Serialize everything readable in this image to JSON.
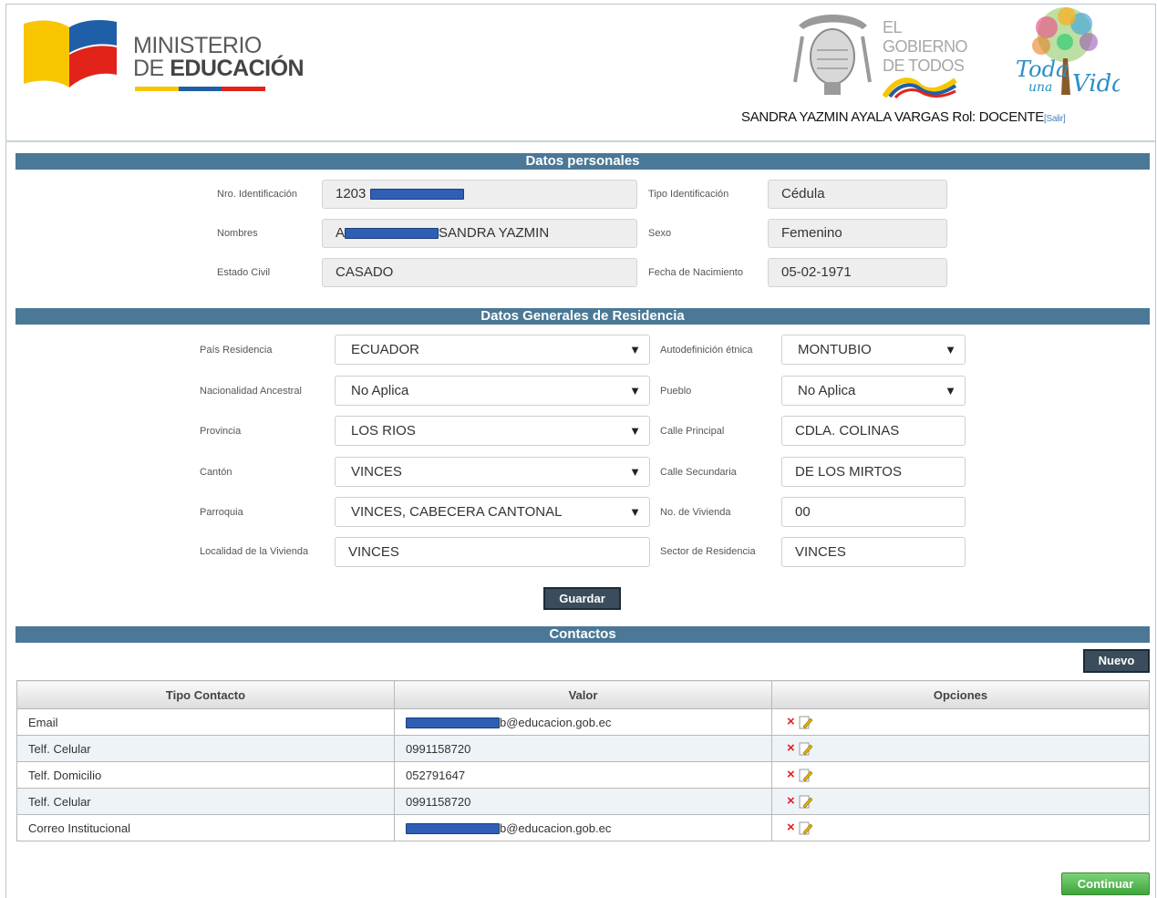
{
  "header": {
    "ministry_line1": "MINISTERIO",
    "ministry_line2_prefix": "DE ",
    "ministry_line2_bold": "EDUCACIÓN",
    "gov_line1": "EL",
    "gov_line2": "GOBIERNO",
    "gov_line3": "DE TODOS",
    "campaign_line1": "Toda",
    "campaign_line2": "una",
    "campaign_line3": "Vida",
    "user_text": "SANDRA YAZMIN AYALA VARGAS Rol: DOCENTE",
    "logout_label": "[Salir]",
    "colors": {
      "yellow": "#f7c600",
      "blue": "#1f5fa8",
      "red": "#e2231a"
    }
  },
  "personal": {
    "title": "Datos personales",
    "id_label": "Nro. Identificación",
    "id_value": "1203",
    "id_type_label": "Tipo Identificación",
    "id_type_value": "Cédula",
    "names_label": "Nombres",
    "names_prefix": "A",
    "names_value": "SANDRA YAZMIN",
    "sex_label": "Sexo",
    "sex_value": "Femenino",
    "civil_label": "Estado Civil",
    "civil_value": "CASADO",
    "birth_label": "Fecha de Nacimiento",
    "birth_value": "05-02-1971"
  },
  "residence": {
    "title": "Datos Generales de Residencia",
    "country_label": "País Residencia",
    "country_value": "ECUADOR",
    "ethnic_label": "Autodefinición étnica",
    "ethnic_value": "MONTUBIO",
    "nationality_label": "Nacionalidad Ancestral",
    "nationality_value": "No Aplica",
    "people_label": "Pueblo",
    "people_value": "No Aplica",
    "province_label": "Provincia",
    "province_value": "LOS RIOS",
    "main_street_label": "Calle Principal",
    "main_street_value": "CDLA. COLINAS",
    "canton_label": "Cantón",
    "canton_value": "VINCES",
    "second_street_label": "Calle Secundaria",
    "second_street_value": "DE LOS MIRTOS",
    "parish_label": "Parroquia",
    "parish_value": "VINCES, CABECERA CANTONAL",
    "house_no_label": "No. de Vivienda",
    "house_no_value": "00",
    "locality_label": "Localidad de la Vivienda",
    "locality_value": "VINCES",
    "sector_label": "Sector de Residencia",
    "sector_value": "VINCES",
    "save_label": "Guardar",
    "dropdown_arrow": "▼"
  },
  "contacts": {
    "title": "Contactos",
    "new_label": "Nuevo",
    "headers": [
      "Tipo Contacto",
      "Valor",
      "Opciones"
    ],
    "rows": [
      {
        "type": "Email",
        "value": "b@educacion.gob.ec",
        "redacted": true
      },
      {
        "type": "Telf. Celular",
        "value": "0991158720",
        "redacted": false
      },
      {
        "type": "Telf. Domicilio",
        "value": "052791647",
        "redacted": false
      },
      {
        "type": "Telf. Celular",
        "value": "0991158720",
        "redacted": false
      },
      {
        "type": "Correo Institucional",
        "value": "b@educacion.gob.ec",
        "redacted": true
      }
    ],
    "delete_icon": "×",
    "edit_icon": "edit-icon",
    "continue_label": "Continuar"
  }
}
